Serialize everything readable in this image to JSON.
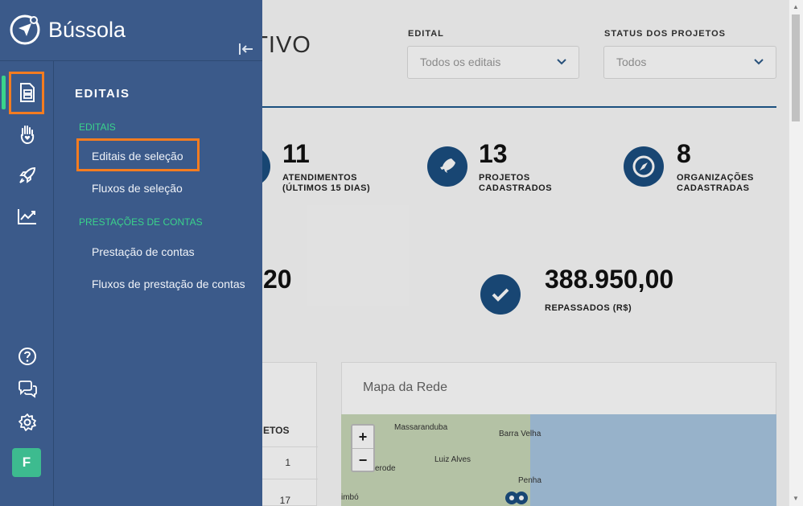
{
  "brand": {
    "name": "Bússola"
  },
  "dashboard": {
    "title_partial": "ATIVO",
    "filters": [
      {
        "label": "EDITAL",
        "value": "Todos os editais"
      },
      {
        "label": "STATUS DOS PROJETOS",
        "value": "Todos"
      }
    ],
    "stats": [
      {
        "value": "11",
        "label": "ATENDIMENTOS (ÚLTIMOS 15 DIAS)"
      },
      {
        "value": "13",
        "label": "PROJETOS CADASTRADOS"
      },
      {
        "value": "8",
        "label": "ORGANIZAÇÕES CADASTRADAS"
      }
    ],
    "money": [
      {
        "value": "20"
      },
      {
        "value": "388.950,00",
        "label": "REPASSADOS (R$)"
      }
    ],
    "table": {
      "header_partial": "ETOS",
      "rows": [
        "1",
        "17"
      ]
    },
    "map": {
      "title": "Mapa da Rede",
      "zoom_in": "+",
      "zoom_out": "−",
      "places": [
        "Massaranduba",
        "Barra Velha",
        "Luiz Alves",
        "erode",
        "Penha",
        "imbó"
      ]
    }
  },
  "sidebar": {
    "menu_title": "EDITAIS",
    "sections": [
      {
        "label": "EDITAIS",
        "items": [
          "Editais de seleção",
          "Fluxos de seleção"
        ]
      },
      {
        "label": "PRESTAÇÕES DE CONTAS",
        "items": [
          "Prestação de contas",
          "Fluxos de prestação de contas"
        ]
      }
    ],
    "user_initial": "F"
  },
  "colors": {
    "sidebar": "#3b5a8a",
    "accent_green": "#3ad38b",
    "highlight": "#f47c20",
    "primary": "#1b4f81"
  }
}
